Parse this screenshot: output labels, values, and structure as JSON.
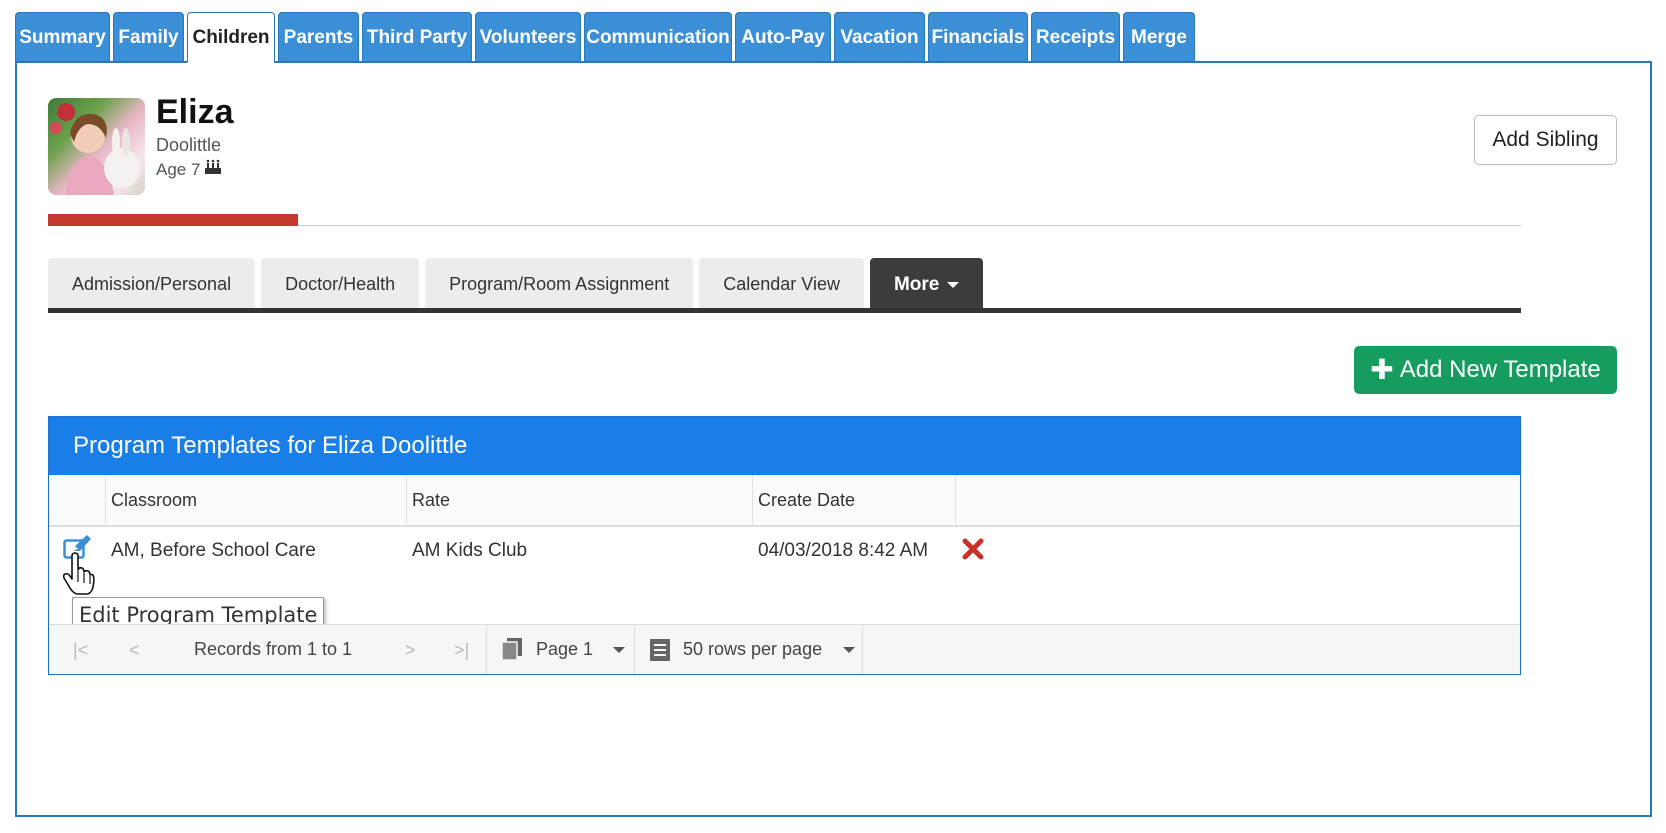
{
  "top_tabs": [
    "Summary",
    "Family",
    "Children",
    "Parents",
    "Third Party",
    "Volunteers",
    "Communication",
    "Auto-Pay",
    "Vacation",
    "Financials",
    "Receipts",
    "Merge"
  ],
  "active_top_tab": "Children",
  "child": {
    "first_name": "Eliza",
    "last_name": "Doolittle",
    "age": "Age 7"
  },
  "add_sibling_label": "Add Sibling",
  "profile_progress": 0.17,
  "sub_tabs": [
    "Admission/Personal",
    "Doctor/Health",
    "Program/Room Assignment",
    "Calendar View"
  ],
  "more_label": "More",
  "add_template_label": "Add New Template",
  "grid": {
    "title": "Program Templates for Eliza Doolittle",
    "columns": [
      "Classroom",
      "Rate",
      "Create Date"
    ],
    "rows": [
      {
        "classroom": "AM, Before School Care",
        "rate": "AM Kids Club",
        "create_date": "04/03/2018 8:42 AM"
      }
    ],
    "edit_tooltip": "Edit Program Template",
    "pager": {
      "records_text": "Records from 1 to 1",
      "page_text": "Page 1",
      "rows_per_page_text": "50 rows per page"
    }
  },
  "colors": {
    "tab_blue": "#3a8fd6",
    "grid_header_blue": "#1a7ee8",
    "add_button_green": "#169c5f",
    "progress_red": "#c53a2e",
    "delete_red": "#c9302c"
  }
}
